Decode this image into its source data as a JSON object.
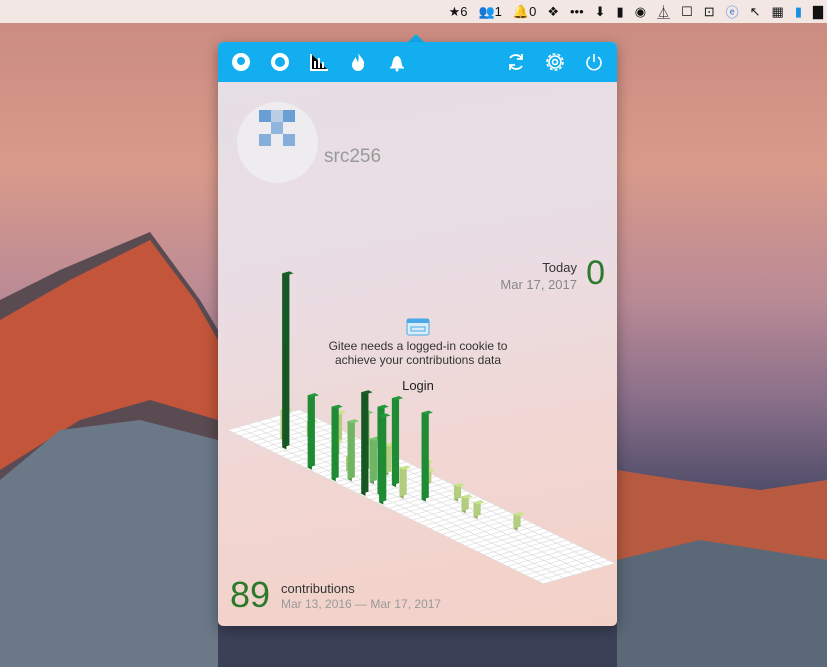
{
  "menubar": {
    "stars": "6",
    "followers": "1",
    "notifications": "0",
    "more": "•••"
  },
  "toolbar": {
    "icons": [
      "github-icon",
      "pie-icon",
      "bar-chart-icon",
      "fire-icon",
      "bell-icon",
      "refresh-icon",
      "gear-icon",
      "power-icon"
    ]
  },
  "profile": {
    "username": "src256"
  },
  "today": {
    "label": "Today",
    "date": "Mar 17, 2017",
    "count": "0"
  },
  "notice": {
    "text": "Gitee needs a logged-in cookie to achieve your contributions data",
    "login": "Login"
  },
  "summary": {
    "total": "89",
    "label": "contributions",
    "range": "Mar 13, 2016 — Mar 17, 2017"
  },
  "colors": {
    "accent": "#13aef0",
    "level1": "#c6e48b",
    "level2": "#7bc96f",
    "level3": "#239a3b",
    "level4": "#196127"
  },
  "chart_data": {
    "type": "isometric-calendar",
    "weeks": 53,
    "days": 7,
    "bars": [
      {
        "week": 5,
        "day": 2,
        "count": 2
      },
      {
        "week": 6,
        "day": 4,
        "count": 1
      },
      {
        "week": 7,
        "day": 1,
        "count": 12
      },
      {
        "week": 9,
        "day": 5,
        "count": 2
      },
      {
        "week": 12,
        "day": 3,
        "count": 1
      },
      {
        "week": 13,
        "day": 0,
        "count": 5
      },
      {
        "week": 16,
        "day": 2,
        "count": 1
      },
      {
        "week": 17,
        "day": 0,
        "count": 5
      },
      {
        "week": 17,
        "day": 3,
        "count": 4
      },
      {
        "week": 18,
        "day": 1,
        "count": 4
      },
      {
        "week": 19,
        "day": 4,
        "count": 2
      },
      {
        "week": 20,
        "day": 2,
        "count": 3
      },
      {
        "week": 22,
        "day": 0,
        "count": 7
      },
      {
        "week": 22,
        "day": 3,
        "count": 6
      },
      {
        "week": 22,
        "day": 6,
        "count": 1
      },
      {
        "week": 23,
        "day": 1,
        "count": 6
      },
      {
        "week": 24,
        "day": 5,
        "count": 1
      },
      {
        "week": 25,
        "day": 2,
        "count": 2
      },
      {
        "week": 25,
        "day": 0,
        "count": 6
      },
      {
        "week": 27,
        "day": 3,
        "count": 6
      },
      {
        "week": 29,
        "day": 5,
        "count": 1
      },
      {
        "week": 32,
        "day": 4,
        "count": 1
      },
      {
        "week": 34,
        "day": 4,
        "count": 1
      },
      {
        "week": 39,
        "day": 5,
        "count": 1
      }
    ]
  }
}
